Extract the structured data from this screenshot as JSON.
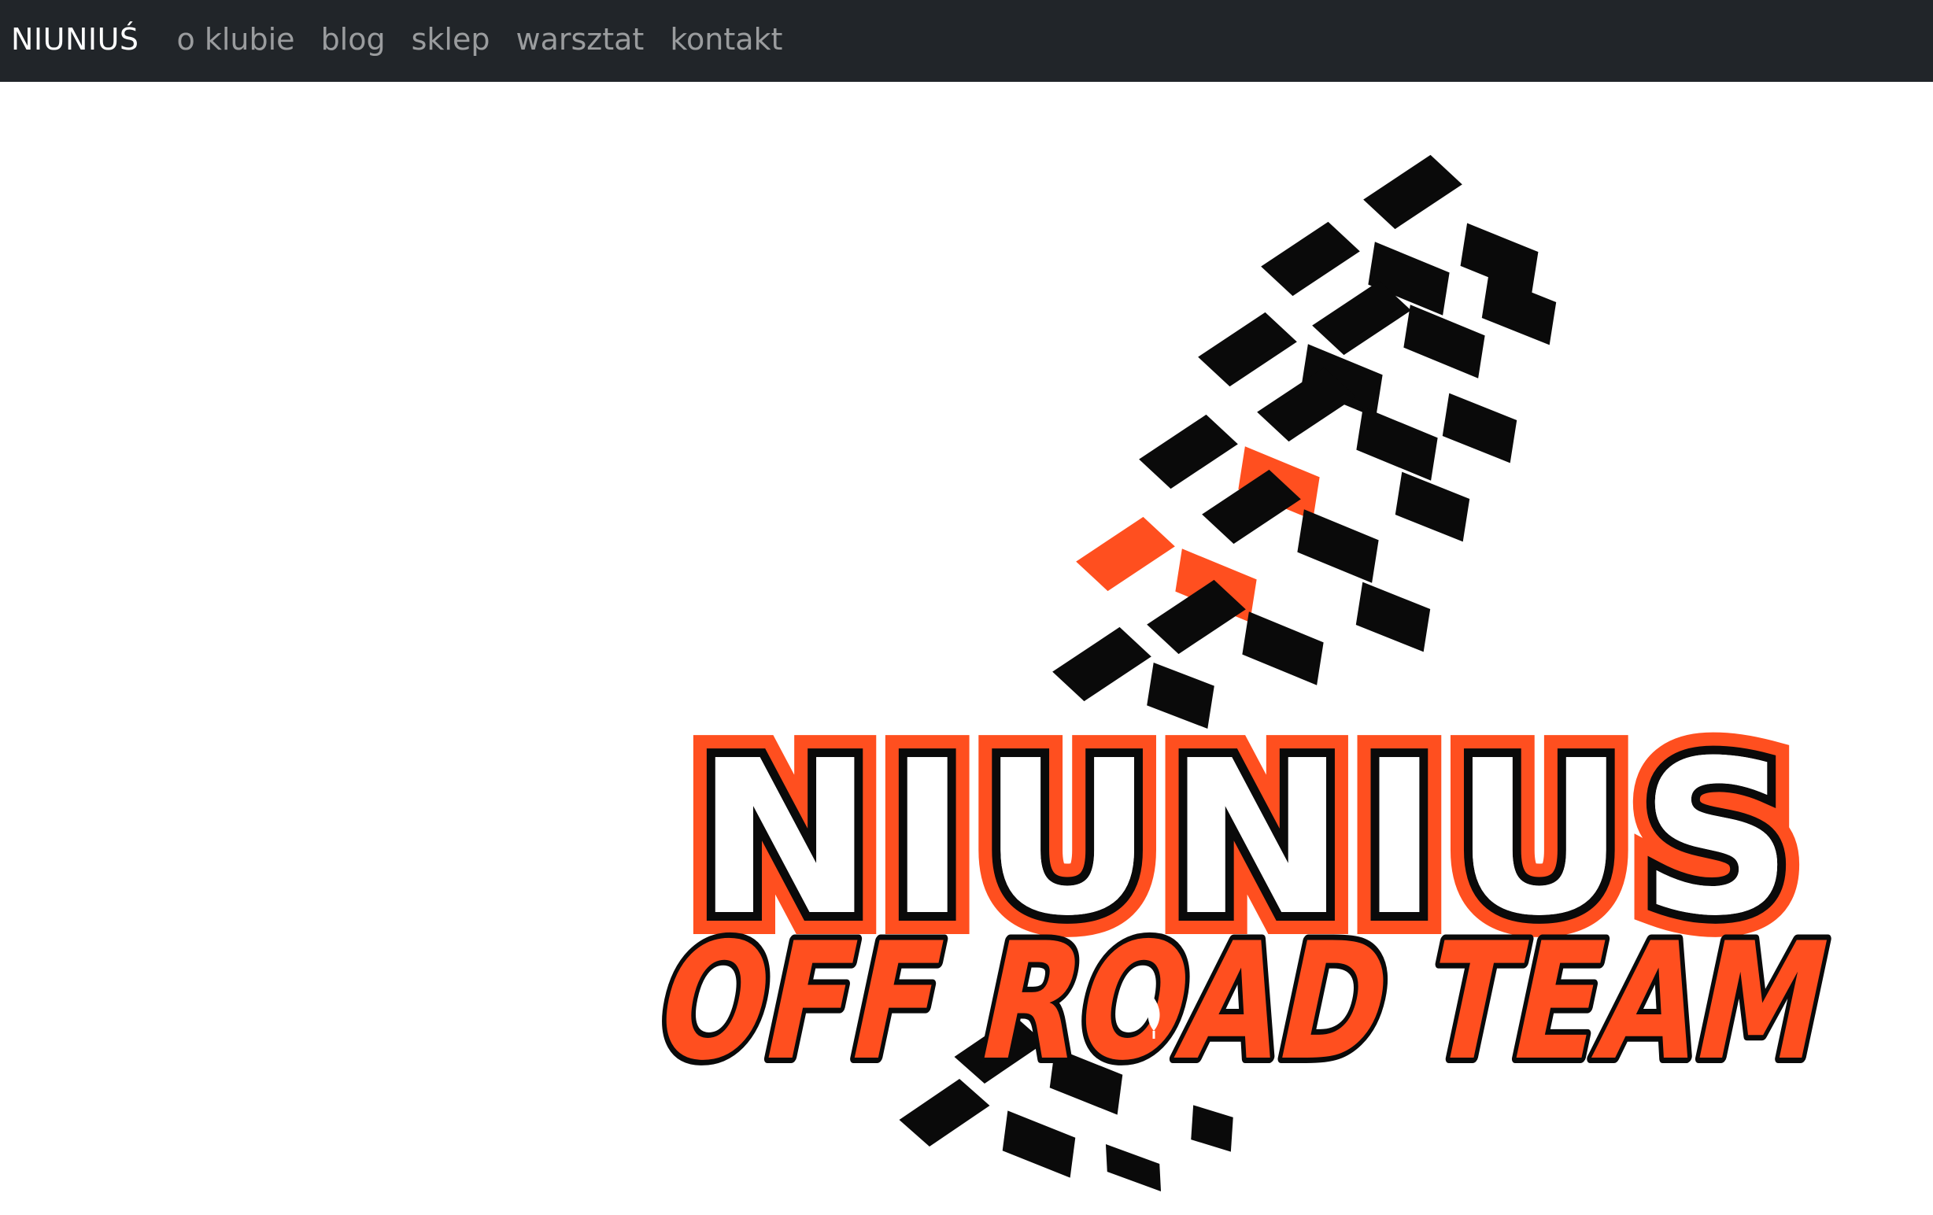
{
  "navbar": {
    "brand": "NIUNIUŚ",
    "links": [
      {
        "label": "o klubie"
      },
      {
        "label": "blog"
      },
      {
        "label": "sklep"
      },
      {
        "label": "warsztat"
      },
      {
        "label": "kontakt"
      }
    ]
  },
  "hero": {
    "logo": {
      "title_text": "NIUNIUS",
      "subtitle_text": "OFF ROAD TEAM"
    }
  },
  "colors": {
    "navbar_bg": "#212529",
    "brand_text": "#ffffff",
    "link_text": "#8f9295",
    "accent_orange": "#ff4f1f",
    "tread_black": "#0a0a0a"
  },
  "icons": [
    "tire-tread-graphic",
    "leaf-icon"
  ]
}
